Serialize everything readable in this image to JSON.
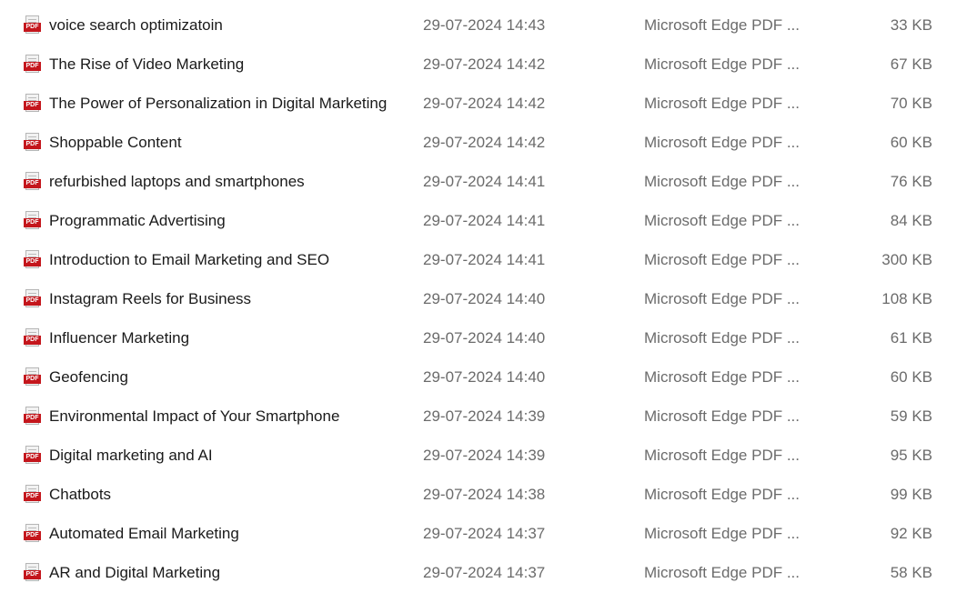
{
  "icon": "pdf-file-icon",
  "files": [
    {
      "name": "voice search optimizatoin",
      "date": "29-07-2024 14:43",
      "type": "Microsoft Edge PDF ...",
      "size": "33 KB"
    },
    {
      "name": "The Rise of Video Marketing",
      "date": "29-07-2024 14:42",
      "type": "Microsoft Edge PDF ...",
      "size": "67 KB"
    },
    {
      "name": "The Power of Personalization in Digital Marketing",
      "date": "29-07-2024 14:42",
      "type": "Microsoft Edge PDF ...",
      "size": "70 KB"
    },
    {
      "name": "Shoppable Content",
      "date": "29-07-2024 14:42",
      "type": "Microsoft Edge PDF ...",
      "size": "60 KB"
    },
    {
      "name": "refurbished laptops and smartphones",
      "date": "29-07-2024 14:41",
      "type": "Microsoft Edge PDF ...",
      "size": "76 KB"
    },
    {
      "name": "Programmatic Advertising",
      "date": "29-07-2024 14:41",
      "type": "Microsoft Edge PDF ...",
      "size": "84 KB"
    },
    {
      "name": "Introduction to Email Marketing and SEO",
      "date": "29-07-2024 14:41",
      "type": "Microsoft Edge PDF ...",
      "size": "300 KB"
    },
    {
      "name": "Instagram Reels for Business",
      "date": "29-07-2024 14:40",
      "type": "Microsoft Edge PDF ...",
      "size": "108 KB"
    },
    {
      "name": "Influencer Marketing",
      "date": "29-07-2024 14:40",
      "type": "Microsoft Edge PDF ...",
      "size": "61 KB"
    },
    {
      "name": "Geofencing",
      "date": "29-07-2024 14:40",
      "type": "Microsoft Edge PDF ...",
      "size": "60 KB"
    },
    {
      "name": "Environmental Impact of Your Smartphone",
      "date": "29-07-2024 14:39",
      "type": "Microsoft Edge PDF ...",
      "size": "59 KB"
    },
    {
      "name": "Digital marketing and AI",
      "date": "29-07-2024 14:39",
      "type": "Microsoft Edge PDF ...",
      "size": "95 KB"
    },
    {
      "name": "Chatbots",
      "date": "29-07-2024 14:38",
      "type": "Microsoft Edge PDF ...",
      "size": "99 KB"
    },
    {
      "name": "Automated Email Marketing",
      "date": "29-07-2024 14:37",
      "type": "Microsoft Edge PDF ...",
      "size": "92 KB"
    },
    {
      "name": "AR and Digital Marketing",
      "date": "29-07-2024 14:37",
      "type": "Microsoft Edge PDF ...",
      "size": "58 KB"
    }
  ]
}
